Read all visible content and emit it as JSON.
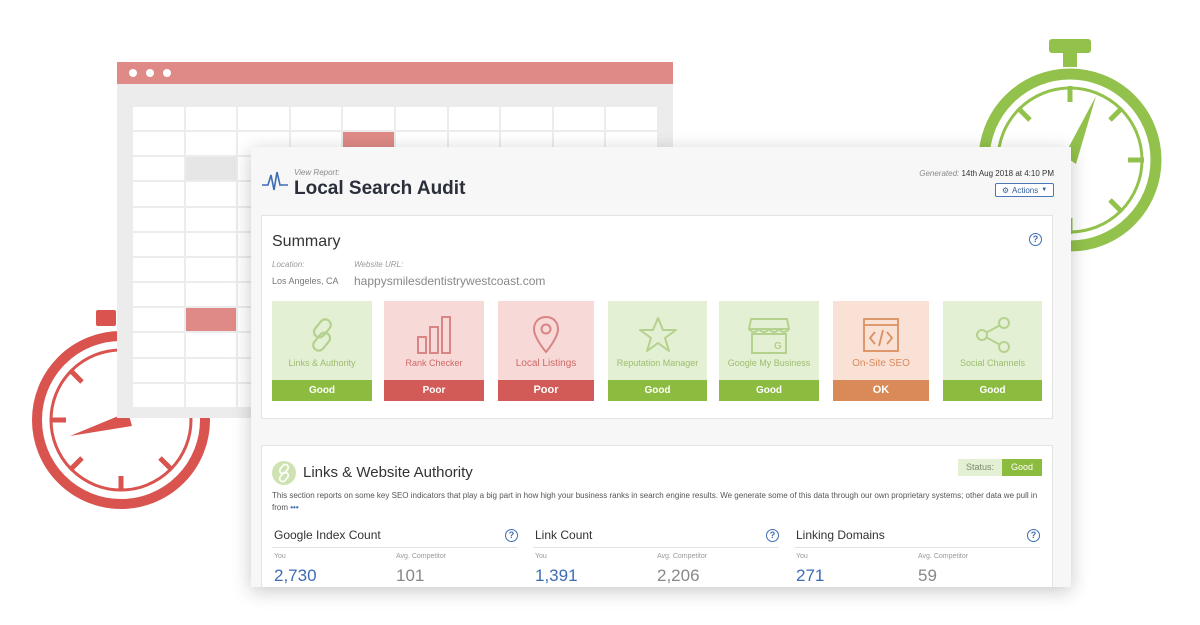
{
  "report": {
    "view_label": "View Report:",
    "title": "Local Search Audit",
    "generated_label": "Generated:",
    "generated_value": "14th Aug 2018 at 4:10 PM",
    "actions_label": "Actions"
  },
  "summary": {
    "title": "Summary",
    "location_label": "Location:",
    "location_value": "Los Angeles, CA",
    "url_label": "Website URL:",
    "url_value": "happysmilesdentistrywestcoast.com",
    "tiles": [
      {
        "label": "Links & Authority",
        "status": "Good",
        "icon": "link-icon"
      },
      {
        "label": "Rank Checker",
        "status": "Poor",
        "icon": "bar-chart-icon"
      },
      {
        "label": "Local Listings",
        "status": "Poor",
        "icon": "map-pin-icon"
      },
      {
        "label": "Reputation Manager",
        "status": "Good",
        "icon": "star-icon"
      },
      {
        "label": "Google My Business",
        "status": "Good",
        "icon": "storefront-icon"
      },
      {
        "label": "On-Site SEO",
        "status": "OK",
        "icon": "code-icon"
      },
      {
        "label": "Social Channels",
        "status": "Good",
        "icon": "share-icon"
      }
    ]
  },
  "authority": {
    "title": "Links & Website Authority",
    "status_label": "Status:",
    "status_value": "Good",
    "description": "This section reports on some key SEO indicators that play a big part in how high your business ranks in search engine results. We generate some of this data through our own proprietary systems; other data we pull in from",
    "more": "•••",
    "metrics": [
      {
        "title": "Google Index Count",
        "you_label": "You",
        "comp_label": "Avg. Competitor",
        "you": "2,730",
        "comp": "101"
      },
      {
        "title": "Link Count",
        "you_label": "You",
        "comp_label": "Avg. Competitor",
        "you": "1,391",
        "comp": "2,206"
      },
      {
        "title": "Linking Domains",
        "you_label": "You",
        "comp_label": "Avg. Competitor",
        "you": "271",
        "comp": "59"
      }
    ]
  },
  "colors": {
    "good": "#8cbc3f",
    "poor": "#d25a57",
    "ok": "#d98a58",
    "link_blue": "#3d6cb3",
    "watch_red": "#d9534f",
    "watch_green": "#93c24c"
  }
}
